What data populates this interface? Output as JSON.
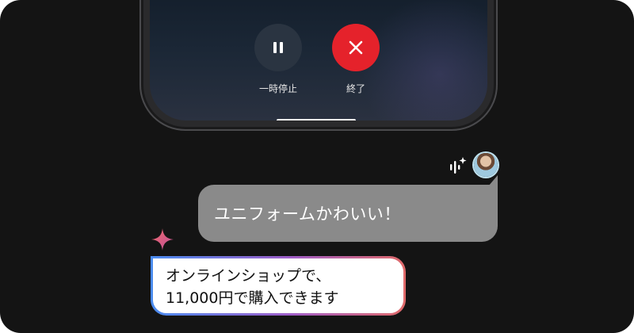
{
  "call_controls": {
    "pause_label": "一時停止",
    "end_label": "終了",
    "pause_icon": "pause-icon",
    "end_icon": "close-icon",
    "end_color": "#e5222b"
  },
  "chat": {
    "user_message": "ユニフォームかわいい！",
    "ai_message_line1": "オンラインショップで、",
    "ai_message_line2": "11,000円で購入できます",
    "voice_icon": "voice-sparkle-icon",
    "assistant_icon": "sparkle-icon"
  }
}
